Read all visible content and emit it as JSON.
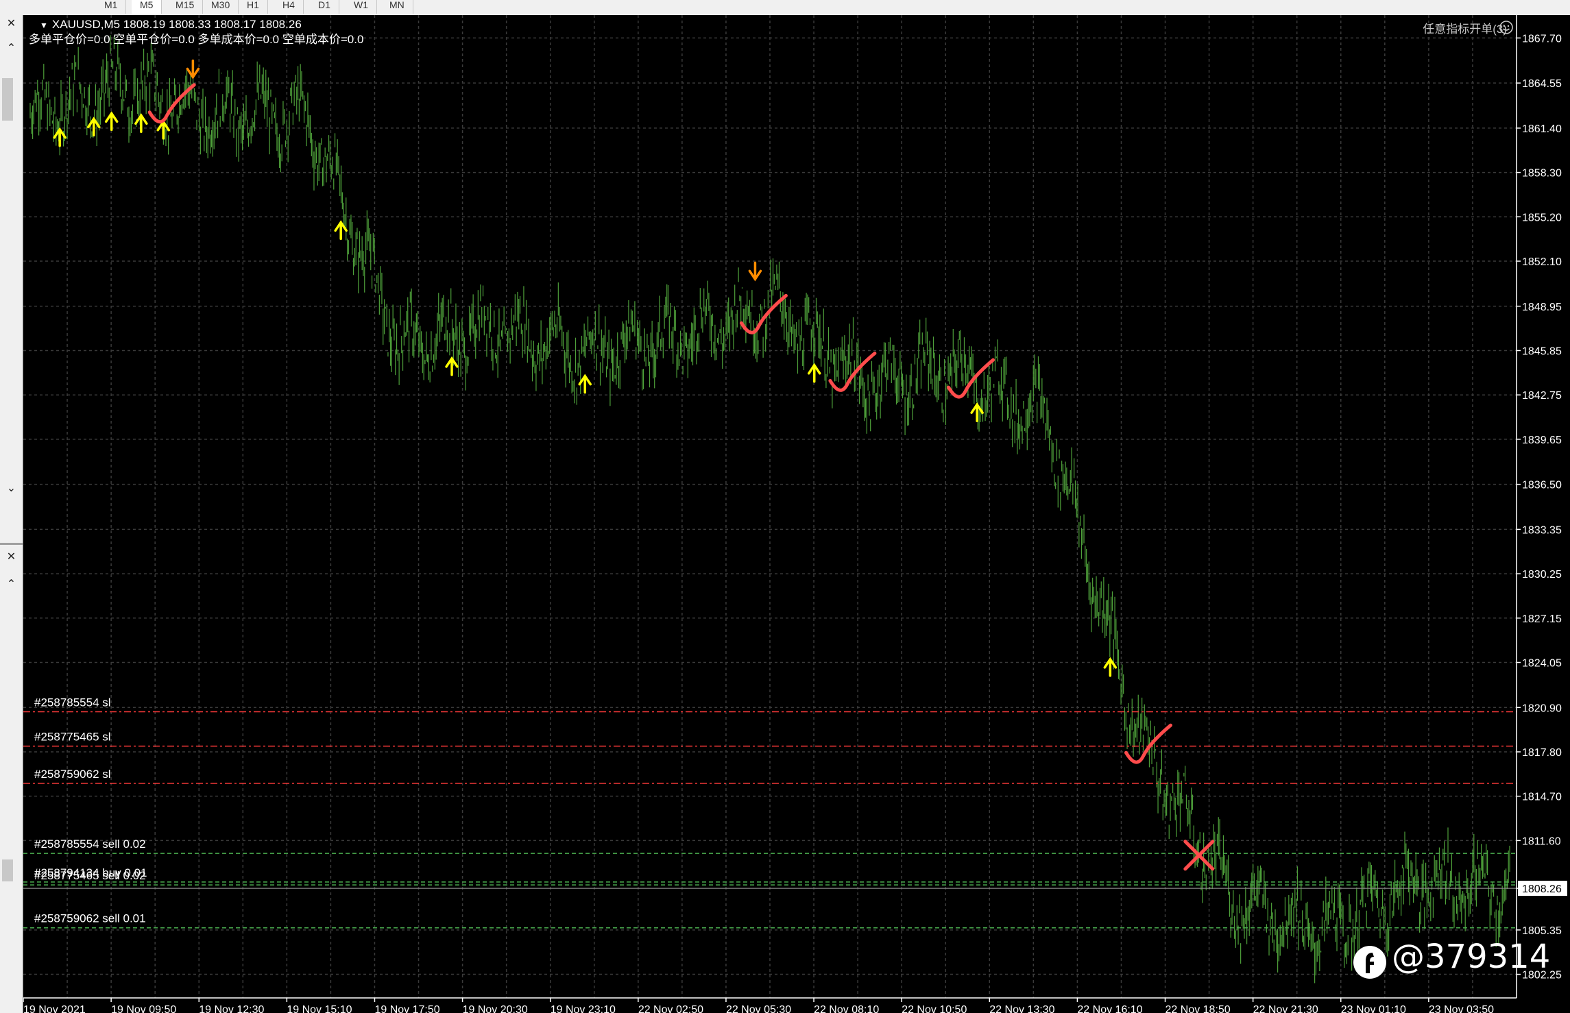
{
  "toolbar": {
    "timeframes": [
      "M1",
      "M5",
      "M15",
      "M30",
      "H1",
      "H4",
      "D1",
      "W1",
      "MN"
    ],
    "active": "M5"
  },
  "chart": {
    "symbol_line": "XAUUSD,M5  1808.19 1808.33 1808.17 1808.26",
    "cost_line": "多单平仓价=0.0 空单平仓价=0.0 多单成本价=0.0 空单成本价=0.0",
    "indicator_label": "任意指标开单(3)",
    "current_price": "1808.26",
    "price_axis": [
      "1867.70",
      "1864.55",
      "1861.40",
      "1858.30",
      "1855.20",
      "1852.10",
      "1848.95",
      "1845.85",
      "1842.75",
      "1839.65",
      "1836.50",
      "1833.35",
      "1830.25",
      "1827.15",
      "1824.05",
      "1820.90",
      "1817.80",
      "1814.70",
      "1811.60",
      "1808.26",
      "1805.35",
      "1802.25"
    ],
    "time_axis": [
      "19 Nov 2021",
      "19 Nov 09:50",
      "19 Nov 12:30",
      "19 Nov 15:10",
      "19 Nov 17:50",
      "19 Nov 20:30",
      "19 Nov 23:10",
      "22 Nov 02:50",
      "22 Nov 05:30",
      "22 Nov 08:10",
      "22 Nov 10:50",
      "22 Nov 13:30",
      "22 Nov 16:10",
      "22 Nov 18:50",
      "22 Nov 21:30",
      "23 Nov 01:10",
      "23 Nov 03:50"
    ],
    "order_labels": [
      {
        "text": "#258785554 sl",
        "color": "#ff3b3b",
        "kind": "sl"
      },
      {
        "text": "#258775465 sl",
        "color": "#ff3b3b",
        "kind": "sl"
      },
      {
        "text": "#258759062 sl",
        "color": "#ff3b3b",
        "kind": "sl"
      },
      {
        "text": "#258785554 sell 0.02",
        "color": "#4caf50",
        "kind": "order"
      },
      {
        "text": "#258794134 buy 0.01",
        "color": "#4caf50",
        "kind": "order"
      },
      {
        "text": "#258775465 sell 0.02",
        "color": "#4caf50",
        "kind": "order"
      },
      {
        "text": "#258759062 sell 0.01",
        "color": "#4caf50",
        "kind": "order"
      }
    ],
    "colors": {
      "background": "#000000",
      "grid": "#3a3a3a",
      "candles": "#4ea03a",
      "buy_arrow": "#ffff00",
      "sell_arrow": "#ff8c00",
      "check_marks": "#ff4c4c",
      "sl_line": "#ff3b3b",
      "order_line": "#4caf50",
      "axis_text": "#ffffff"
    }
  },
  "chart_data": {
    "type": "line",
    "ylim": [
      1800.6,
      1869.3
    ],
    "x": [
      "19 Nov 2021",
      "19 Nov 09:50",
      "19 Nov 12:30",
      "19 Nov 15:10",
      "19 Nov 17:50",
      "19 Nov 20:30",
      "19 Nov 23:10",
      "22 Nov 02:50",
      "22 Nov 05:30",
      "22 Nov 08:10",
      "22 Nov 10:50",
      "22 Nov 13:30",
      "22 Nov 16:10",
      "22 Nov 18:50",
      "22 Nov 21:30",
      "23 Nov 01:10",
      "23 Nov 03:50"
    ],
    "series": [
      {
        "values": [
          1862.3,
          1864.3,
          1862.4,
          1862.2,
          1846.2,
          1847.5,
          1845.7,
          1846.8,
          1849.1,
          1843.6,
          1844.5,
          1841.2,
          1818.7,
          1807.5,
          1805.2,
          1808.9,
          1808.1
        ]
      }
    ],
    "grid": true,
    "buy_signal_count": 11,
    "sell_signal_count": 2,
    "sl_levels": [
      1820.6,
      1818.2,
      1815.6
    ],
    "order_levels": [
      1810.7,
      1808.7,
      1808.5,
      1805.5
    ]
  },
  "watermark": "@379314"
}
